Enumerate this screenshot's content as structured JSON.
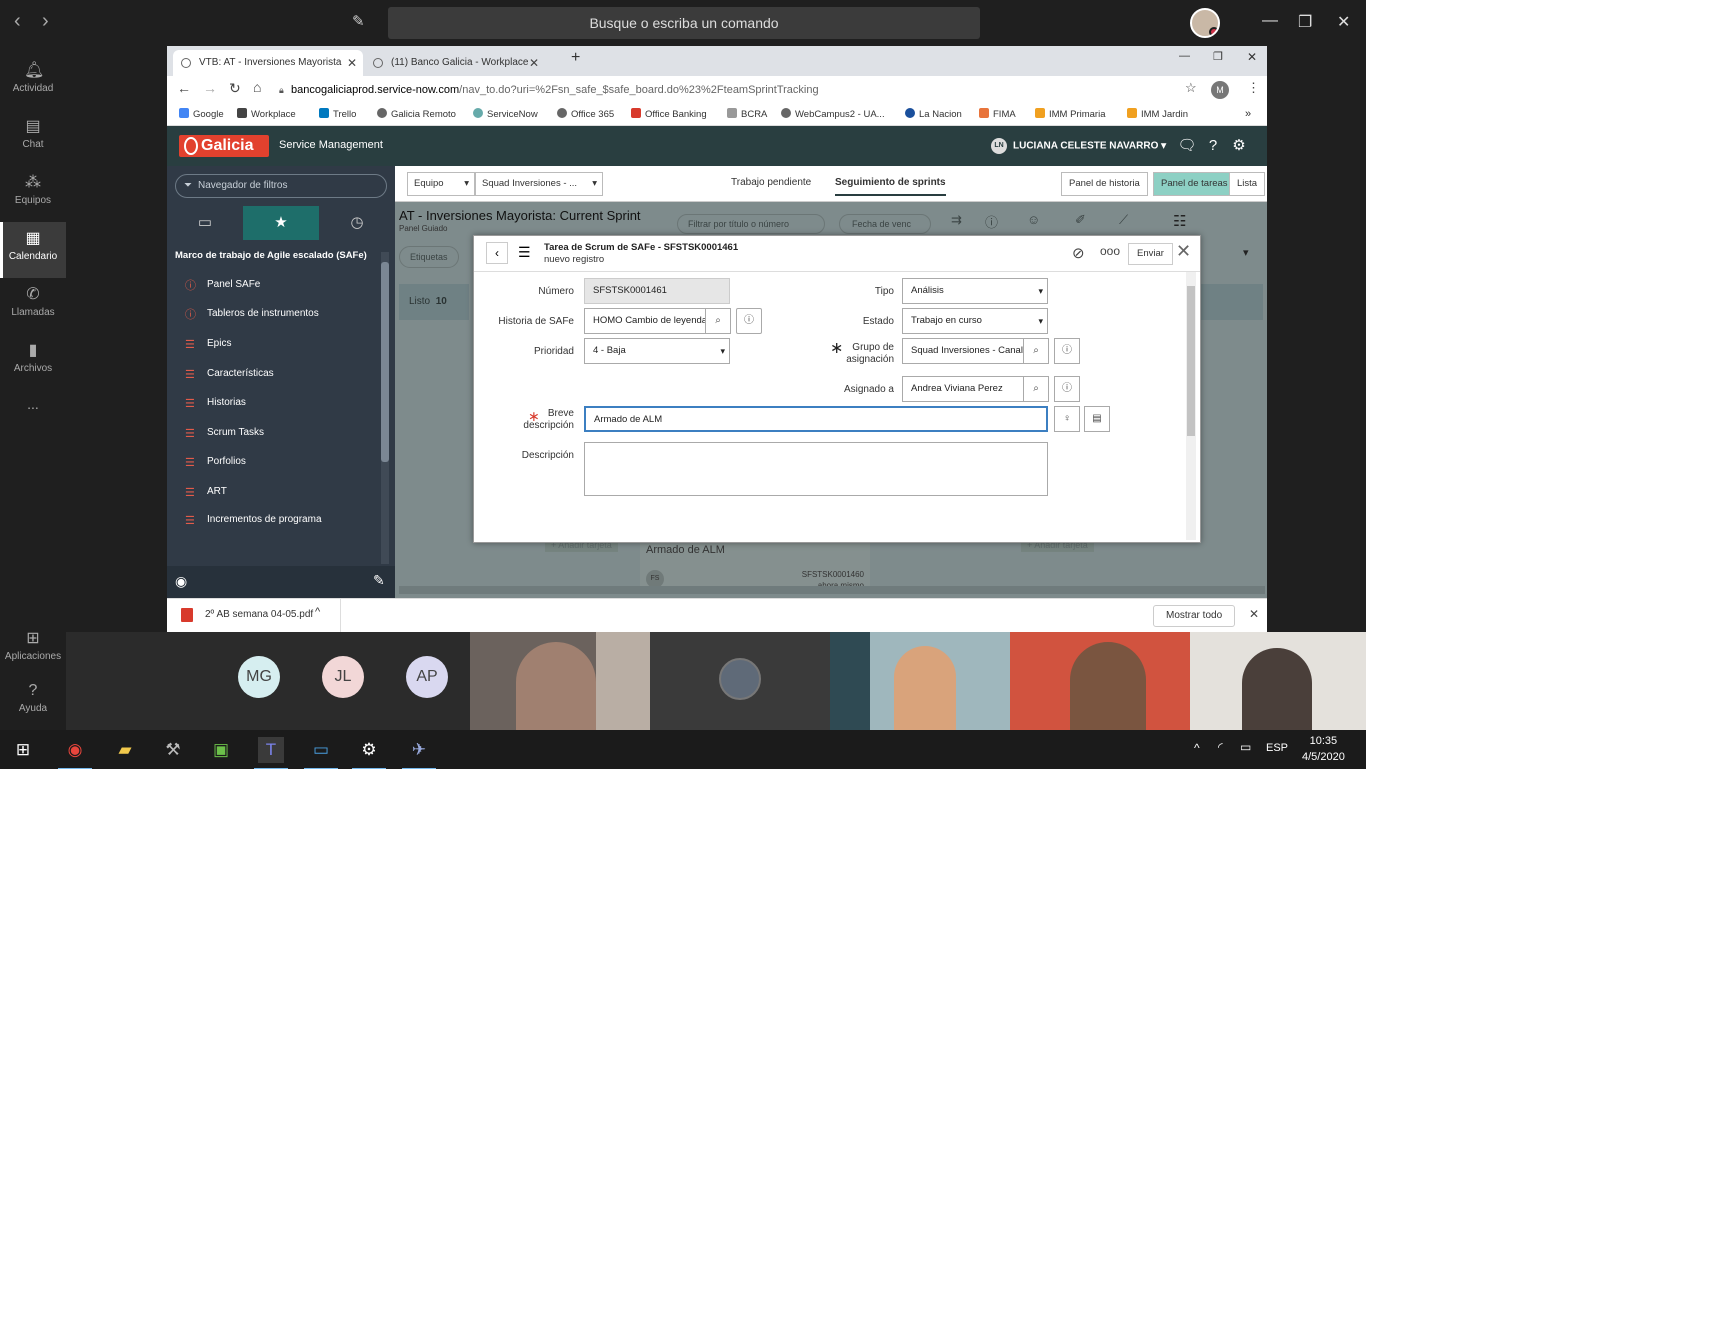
{
  "teams": {
    "search_placeholder": "Busque o escriba un comando",
    "rail": [
      {
        "label": "Actividad",
        "icon": "bell-icon"
      },
      {
        "label": "Chat",
        "icon": "chat-icon"
      },
      {
        "label": "Equipos",
        "icon": "teams-icon"
      },
      {
        "label": "Calendario",
        "icon": "calendar-icon"
      },
      {
        "label": "Llamadas",
        "icon": "phone-icon"
      },
      {
        "label": "Archivos",
        "icon": "file-icon"
      },
      {
        "label": "...",
        "icon": "more-icon"
      },
      {
        "label": "Aplicaciones",
        "icon": "apps-icon"
      },
      {
        "label": "Ayuda",
        "icon": "help-icon"
      }
    ]
  },
  "browser": {
    "tabs": [
      {
        "title": "VTB: AT - Inversiones Mayorista"
      },
      {
        "title": "(11) Banco Galicia - Workplace"
      }
    ],
    "url_domain": "bancogaliciaprod.service-now.com",
    "url_path": "/nav_to.do?uri=%2Fsn_safe_$safe_board.do%23%2FteamSprintTracking",
    "profile_initial": "M",
    "bookmarks": [
      "Google",
      "Workplace",
      "Trello",
      "Galicia Remoto",
      "ServiceNow",
      "Office 365",
      "Office Banking",
      "BCRA",
      "WebCampus2 - UA...",
      "La Nacion",
      "FIMA",
      "IMM Primaria",
      "IMM Jardin"
    ],
    "more_bookmarks": "»"
  },
  "sn": {
    "brand": "Galicia",
    "product": "Service Management",
    "user_initials": "LN",
    "user_name": "LUCIANA CELESTE NAVARRO",
    "filter_placeholder": "Navegador de filtros",
    "nav_heading": "Marco de trabajo de Agile escalado (SAFe)",
    "nav_items": [
      "Panel SAFe",
      "Tableros de instrumentos",
      "Epics",
      "Características",
      "Historias",
      "Scrum Tasks",
      "Porfolios",
      "ART",
      "Incrementos de programa"
    ],
    "toolbar": {
      "select1": "Equipo",
      "select2": "Squad Inversiones - ...",
      "link1": "Trabajo pendiente",
      "link2": "Seguimiento de sprints",
      "seg1": "Panel de historia",
      "seg2": "Panel de tareas",
      "seg3": "Lista"
    },
    "board_title": "AT - Inversiones Mayorista: Current Sprint",
    "board_sub": "Panel Guiado",
    "filter_title": "Filtrar por título o número",
    "filter_date": "Fecha de venc",
    "tags_label": "Etiquetas",
    "column_label": "Listo",
    "column_count": "10",
    "add_card_1": "+ Añadir tarjeta",
    "add_card_2": "+ Añadir tarjeta",
    "card_title": "Armado de ALM",
    "card_number": "SFSTSK0001460",
    "card_badge": "FS",
    "card_time": "ahora mismo"
  },
  "modal": {
    "title": "Tarea de Scrum de SAFe - SFSTSK0001461",
    "subtitle": "nuevo registro",
    "send_label": "Enviar",
    "fields": {
      "numero_label": "Número",
      "numero_value": "SFSTSK0001461",
      "historia_label": "Historia de SAFe",
      "historia_value": "HOMO Cambio de leyenda",
      "prioridad_label": "Prioridad",
      "prioridad_value": "4 - Baja",
      "tipo_label": "Tipo",
      "tipo_value": "Análisis",
      "estado_label": "Estado",
      "estado_value": "Trabajo en curso",
      "grupo_label_1": "Grupo de",
      "grupo_label_2": "asignación",
      "grupo_value": "Squad Inversiones - Canal",
      "asignado_label": "Asignado a",
      "asignado_value": "Andrea Viviana Perez",
      "breve_label_1": "Breve",
      "breve_label_2": "descripción",
      "breve_value": "Armado de ALM",
      "descripcion_label": "Descripción",
      "descripcion_value": ""
    }
  },
  "download": {
    "file_name": "2º AB semana 04-05.pdf",
    "show_all": "Mostrar todo"
  },
  "gallery": {
    "avatars": [
      "MG",
      "JL",
      "AP"
    ]
  },
  "taskbar": {
    "lang": "ESP",
    "time": "10:35",
    "date": "4/5/2020"
  }
}
